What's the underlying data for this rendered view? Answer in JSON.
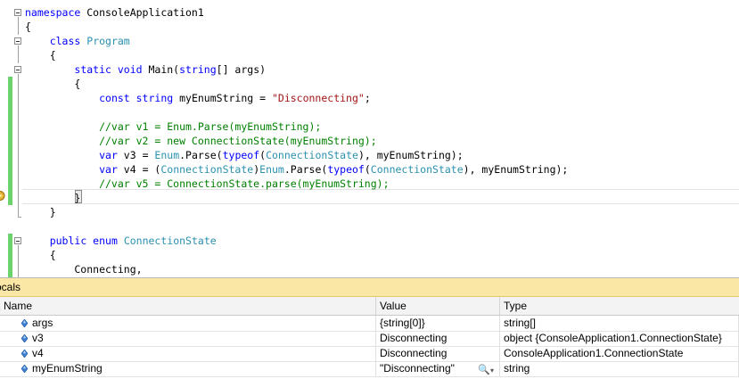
{
  "editor": {
    "lines": [
      [
        {
          "t": "namespace",
          "c": "kw"
        },
        {
          "t": " ConsoleApplication1",
          "c": ""
        }
      ],
      [
        {
          "t": "{",
          "c": ""
        }
      ],
      [
        {
          "t": "    ",
          "c": ""
        },
        {
          "t": "class",
          "c": "kw"
        },
        {
          "t": " ",
          "c": ""
        },
        {
          "t": "Program",
          "c": "ty"
        }
      ],
      [
        {
          "t": "    {",
          "c": ""
        }
      ],
      [
        {
          "t": "        ",
          "c": ""
        },
        {
          "t": "static void",
          "c": "kw"
        },
        {
          "t": " Main(",
          "c": ""
        },
        {
          "t": "string",
          "c": "kw"
        },
        {
          "t": "[] args)",
          "c": ""
        }
      ],
      [
        {
          "t": "        {",
          "c": ""
        }
      ],
      [
        {
          "t": "            ",
          "c": ""
        },
        {
          "t": "const string",
          "c": "kw"
        },
        {
          "t": " myEnumString = ",
          "c": ""
        },
        {
          "t": "\"Disconnecting\"",
          "c": "str"
        },
        {
          "t": ";",
          "c": ""
        }
      ],
      [
        {
          "t": "",
          "c": ""
        }
      ],
      [
        {
          "t": "            //var v1 = Enum.Parse(myEnumString);",
          "c": "cm"
        }
      ],
      [
        {
          "t": "            //var v2 = new ConnectionState(myEnumString);",
          "c": "cm"
        }
      ],
      [
        {
          "t": "            ",
          "c": ""
        },
        {
          "t": "var",
          "c": "kw"
        },
        {
          "t": " v3 = ",
          "c": ""
        },
        {
          "t": "Enum",
          "c": "ty"
        },
        {
          "t": ".Parse(",
          "c": ""
        },
        {
          "t": "typeof",
          "c": "kw"
        },
        {
          "t": "(",
          "c": ""
        },
        {
          "t": "ConnectionState",
          "c": "ty"
        },
        {
          "t": "), myEnumString);",
          "c": ""
        }
      ],
      [
        {
          "t": "            ",
          "c": ""
        },
        {
          "t": "var",
          "c": "kw"
        },
        {
          "t": " v4 = (",
          "c": ""
        },
        {
          "t": "ConnectionState",
          "c": "ty"
        },
        {
          "t": ")",
          "c": ""
        },
        {
          "t": "Enum",
          "c": "ty"
        },
        {
          "t": ".Parse(",
          "c": ""
        },
        {
          "t": "typeof",
          "c": "kw"
        },
        {
          "t": "(",
          "c": ""
        },
        {
          "t": "ConnectionState",
          "c": "ty"
        },
        {
          "t": "), myEnumString);",
          "c": ""
        }
      ],
      [
        {
          "t": "            //var v5 = ConnectionState.parse(myEnumString);",
          "c": "cm"
        }
      ],
      [
        {
          "t": "        }",
          "c": ""
        }
      ],
      [
        {
          "t": "    }",
          "c": ""
        }
      ],
      [
        {
          "t": "",
          "c": ""
        }
      ],
      [
        {
          "t": "    ",
          "c": ""
        },
        {
          "t": "public enum",
          "c": "kw"
        },
        {
          "t": " ",
          "c": ""
        },
        {
          "t": "ConnectionState",
          "c": "ty"
        }
      ],
      [
        {
          "t": "    {",
          "c": ""
        }
      ],
      [
        {
          "t": "        Connecting,",
          "c": ""
        }
      ]
    ],
    "colors": {
      "keyword": "#0000ff",
      "type": "#2b91af",
      "string": "#a31515",
      "comment": "#008000",
      "change_bar": "#6cd26c",
      "title_bar": "#fbe7a5"
    }
  },
  "locals": {
    "title": "ocals",
    "columns": {
      "name": "Name",
      "value": "Value",
      "type": "Type"
    },
    "rows": [
      {
        "name": "args",
        "value": "{string[0]}",
        "type": "string[]",
        "icon": "variable-icon"
      },
      {
        "name": "v3",
        "value": "Disconnecting",
        "type": "object {ConsoleApplication1.ConnectionState}",
        "icon": "variable-icon"
      },
      {
        "name": "v4",
        "value": "Disconnecting",
        "type": "ConsoleApplication1.ConnectionState",
        "icon": "variable-icon"
      },
      {
        "name": "myEnumString",
        "value": "\"Disconnecting\"",
        "type": "string",
        "icon": "variable-icon",
        "visualizer": "magnifier-icon"
      }
    ]
  }
}
